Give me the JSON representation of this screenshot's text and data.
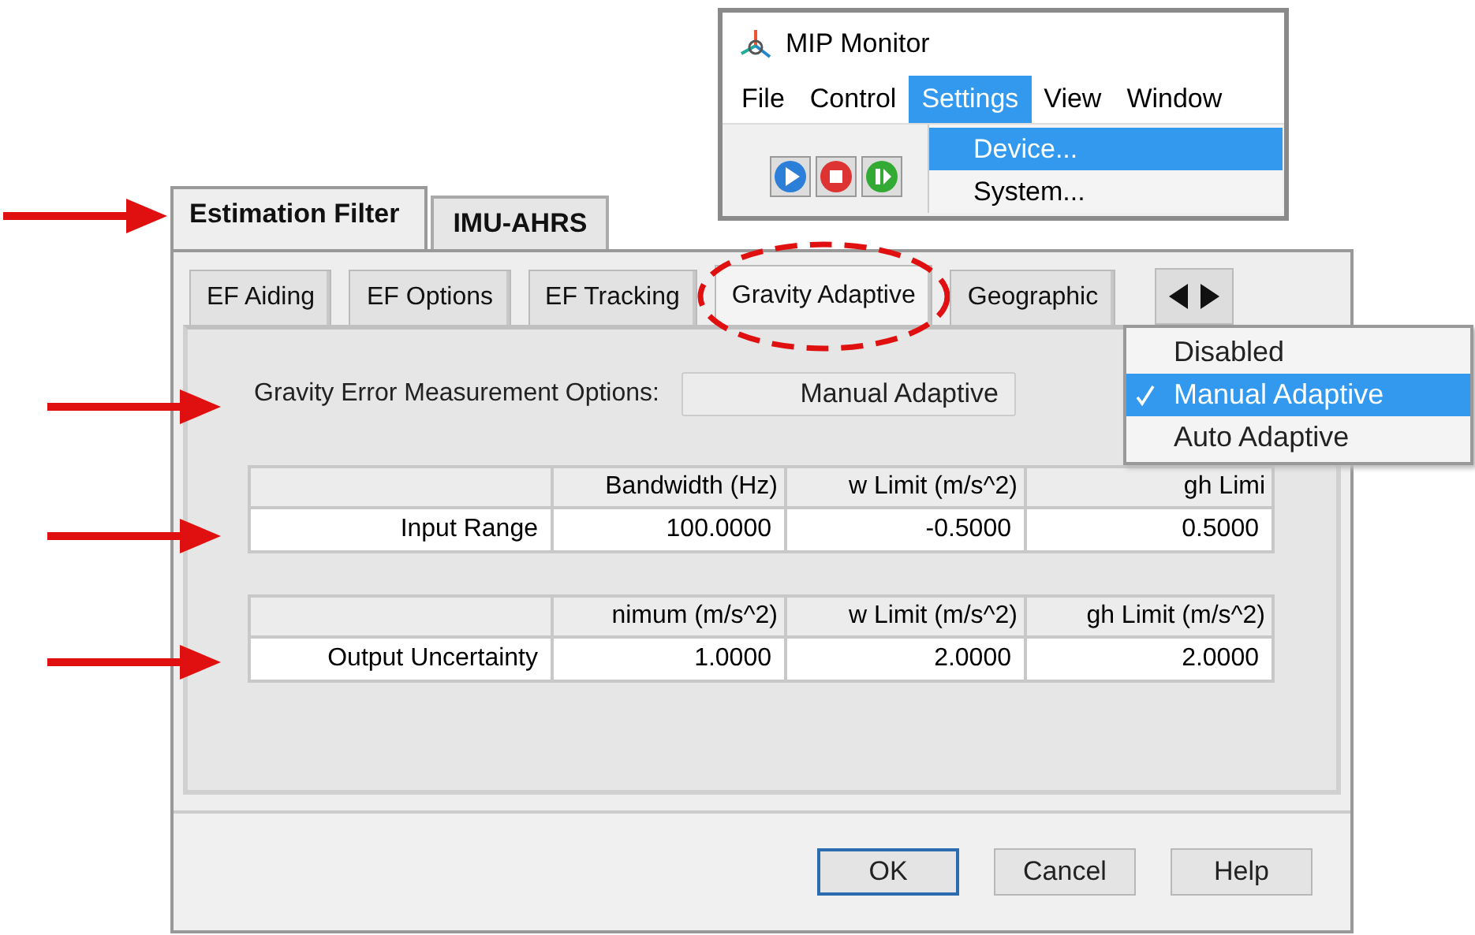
{
  "dialog": {
    "tabs": [
      {
        "label": "Estimation Filter",
        "selected": true
      },
      {
        "label": "IMU-AHRS",
        "selected": false
      }
    ],
    "subtabs": [
      {
        "label": "EF Aiding",
        "selected": false
      },
      {
        "label": "EF Options",
        "selected": false
      },
      {
        "label": "EF Tracking",
        "selected": false
      },
      {
        "label": "Gravity Adaptive",
        "selected": true
      },
      {
        "label": "Geographic",
        "selected": false
      }
    ],
    "option": {
      "label": "Gravity Error Measurement Options:",
      "value": "Manual Adaptive"
    },
    "option_menu": [
      {
        "label": "Disabled",
        "selected": false
      },
      {
        "label": "Manual Adaptive",
        "selected": true
      },
      {
        "label": "Auto Adaptive",
        "selected": false
      }
    ],
    "tables": [
      {
        "columns": [
          "Bandwidth (Hz)",
          "w Limit (m/s^2)",
          "gh Limi"
        ],
        "rows": [
          {
            "label": "Input Range",
            "cells": [
              "100.0000",
              "-0.5000",
              "0.5000"
            ]
          }
        ]
      },
      {
        "columns": [
          "nimum (m/s^2)",
          "w Limit (m/s^2)",
          "gh Limit (m/s^2)"
        ],
        "rows": [
          {
            "label": "Output Uncertainty",
            "cells": [
              "1.0000",
              "2.0000",
              "2.0000"
            ]
          }
        ]
      }
    ],
    "buttons": [
      {
        "label": "OK",
        "default": true
      },
      {
        "label": "Cancel",
        "default": false
      },
      {
        "label": "Help",
        "default": false
      }
    ]
  },
  "monitor_window": {
    "title": "MIP Monitor",
    "menu": [
      {
        "label": "File",
        "selected": false
      },
      {
        "label": "Control",
        "selected": false
      },
      {
        "label": "Settings",
        "selected": true
      },
      {
        "label": "View",
        "selected": false
      },
      {
        "label": "Window",
        "selected": false
      }
    ],
    "settings_menu": [
      {
        "label": "Device...",
        "selected": true
      },
      {
        "label": "System...",
        "selected": false
      }
    ]
  }
}
